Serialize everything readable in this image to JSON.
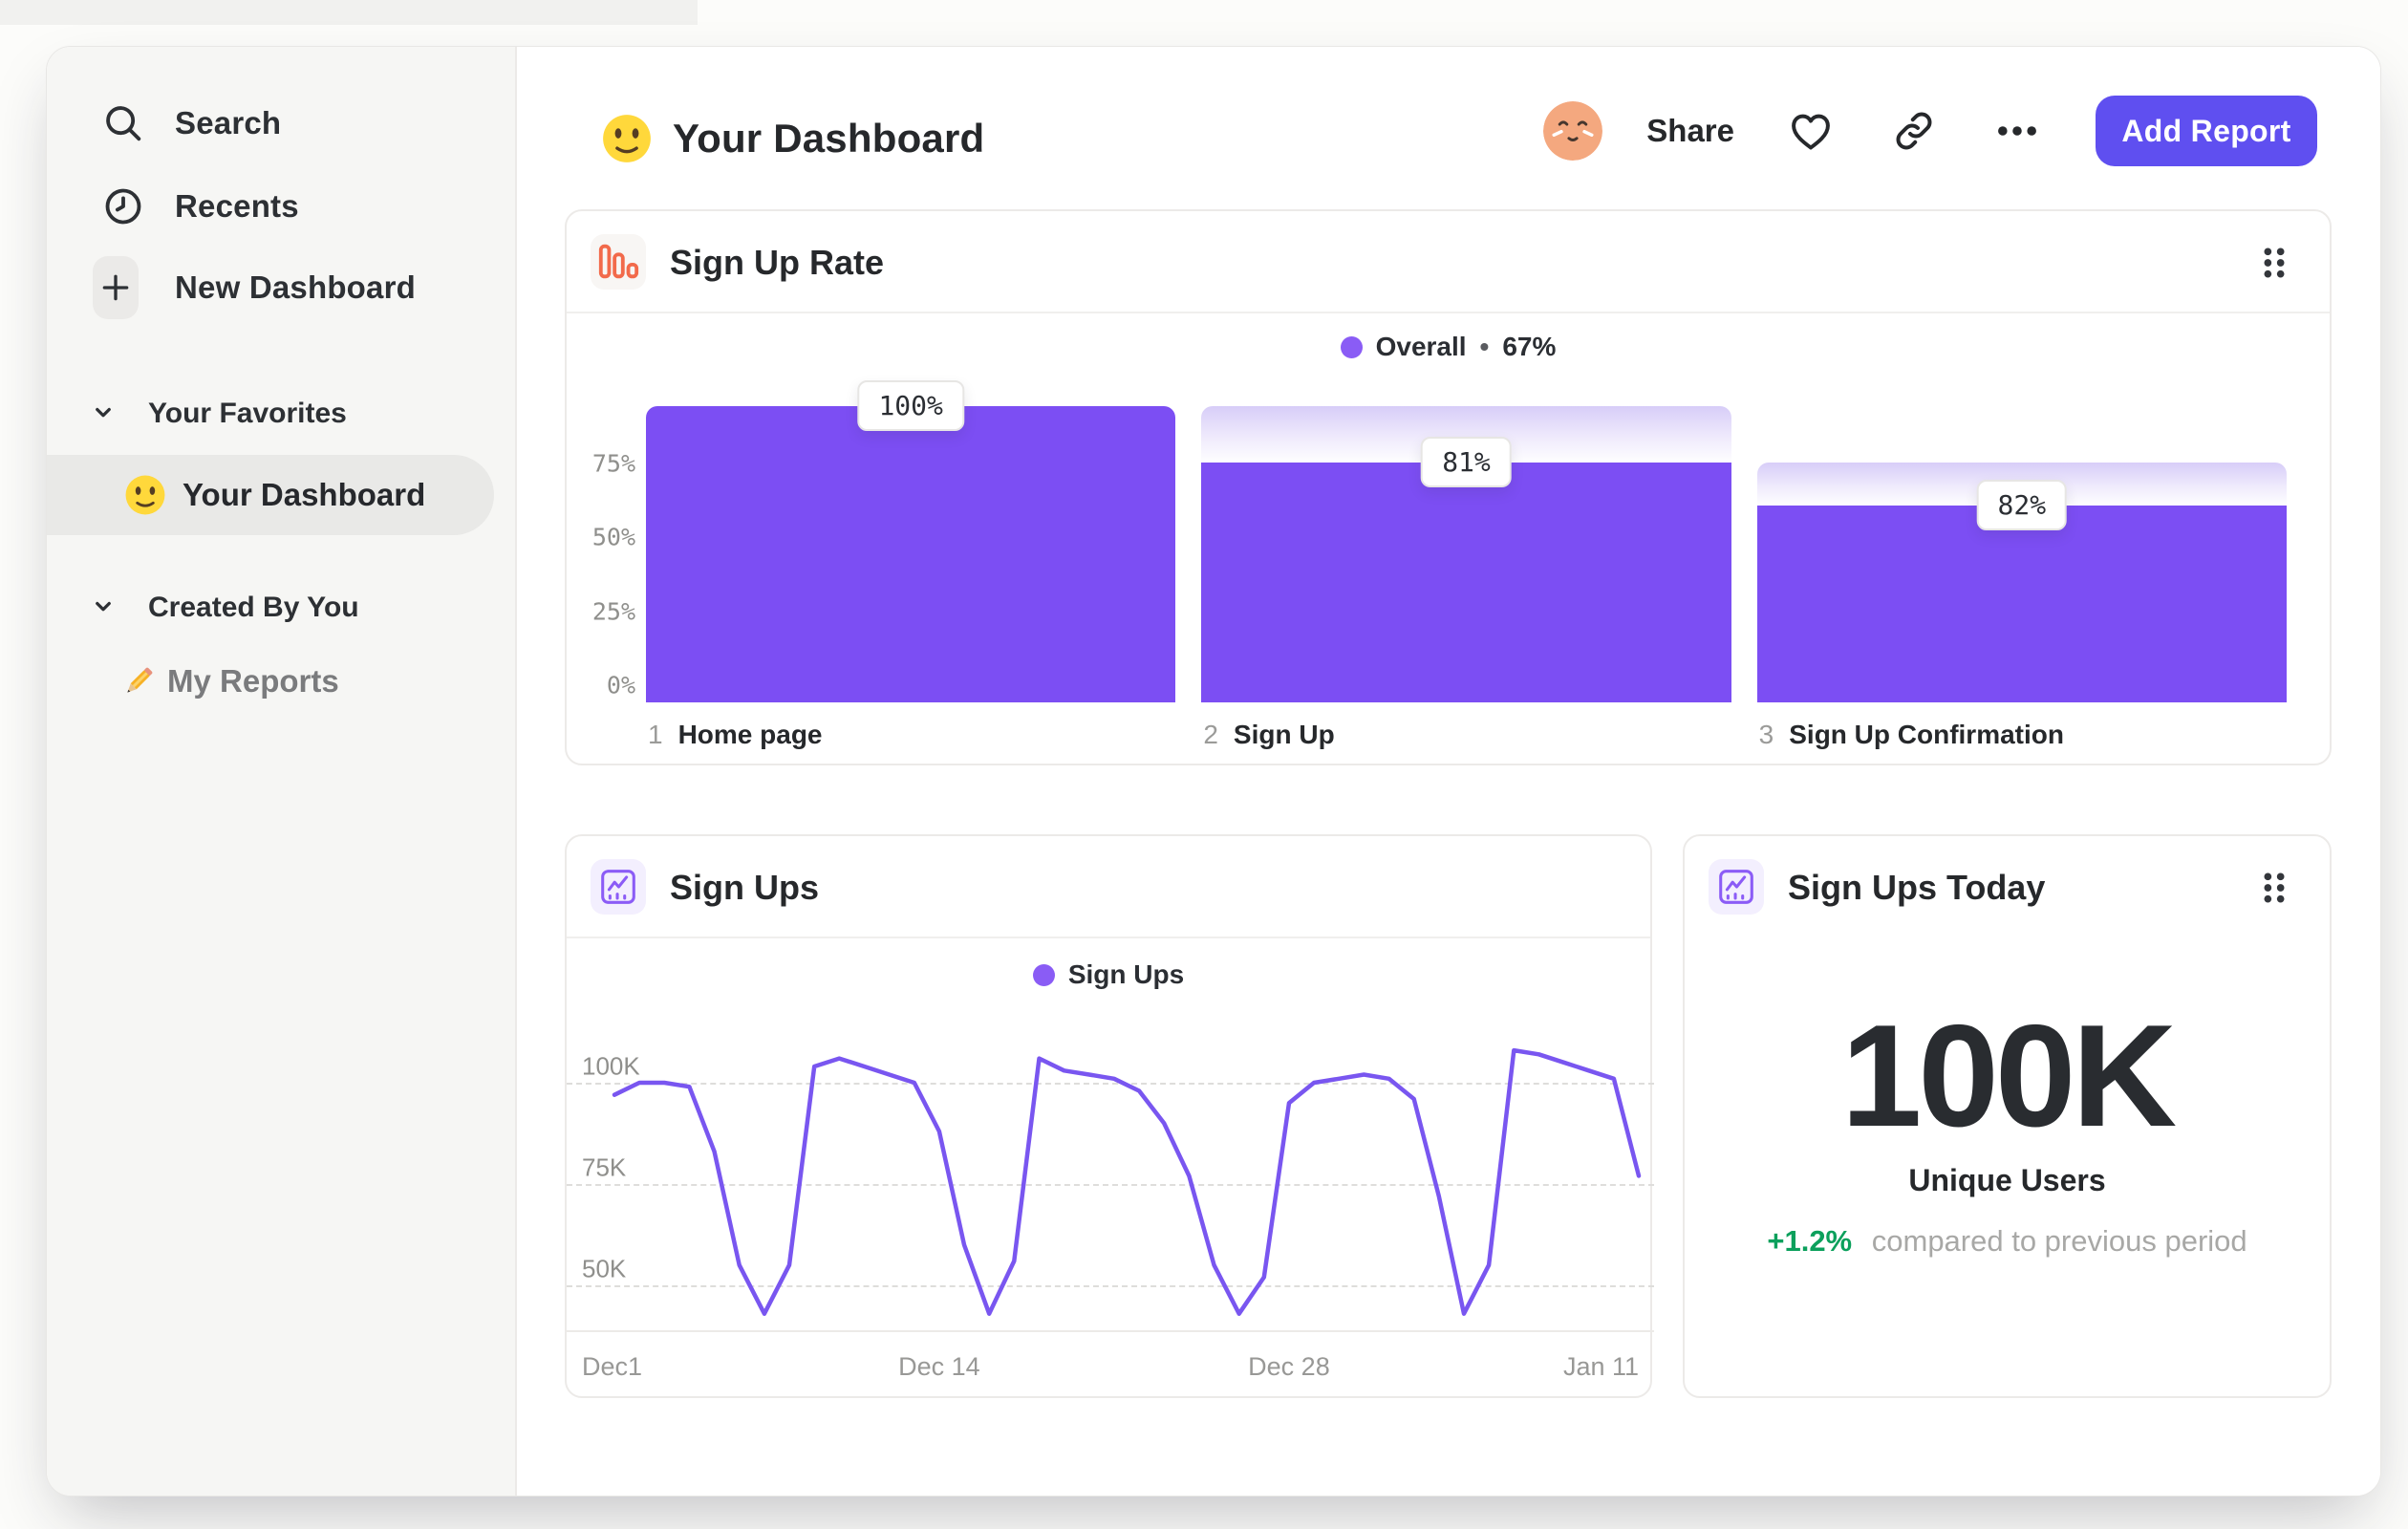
{
  "colors": {
    "accent_purple": "#7c4ef3",
    "line_purple": "#7956f0",
    "legend_dot": "#8a5cf5",
    "button_purple": "#5f4ff0",
    "icon_orange": "#f26a4b",
    "icon_purple": "#8b5cf6",
    "positive_green": "#0ca05c"
  },
  "sidebar": {
    "items": [
      {
        "label": "Search",
        "icon": "search-icon"
      },
      {
        "label": "Recents",
        "icon": "clock-icon"
      },
      {
        "label": "New Dashboard",
        "icon": "plus-icon"
      }
    ],
    "sections": [
      {
        "title": "Your Favorites",
        "items": [
          {
            "label": "Your Dashboard",
            "emoji": "smiley-emoji",
            "selected": true
          }
        ]
      },
      {
        "title": "Created By You",
        "items": [
          {
            "label": "My Reports",
            "emoji": "pencil-emoji",
            "selected": false
          }
        ]
      }
    ]
  },
  "header": {
    "emoji": "smiley-emoji",
    "title": "Your Dashboard",
    "share_label": "Share",
    "add_report_label": "Add Report",
    "icons": [
      "avatar",
      "heart-icon",
      "link-icon",
      "ellipsis-icon"
    ]
  },
  "cards": {
    "funnel": {
      "title": "Sign Up Rate",
      "legend_label": "Overall",
      "legend_sep": "•",
      "legend_value": "67%"
    },
    "line": {
      "title": "Sign Ups",
      "legend_label": "Sign Ups"
    },
    "metric": {
      "title": "Sign Ups Today",
      "value": "100K",
      "label": "Unique Users",
      "delta": "+1.2%",
      "delta_note": "compared to previous period"
    }
  },
  "chart_data": [
    {
      "type": "bar",
      "title": "Sign Up Rate",
      "legend": [
        {
          "name": "Overall",
          "value": "67%"
        }
      ],
      "ylim": [
        0,
        100
      ],
      "grid": false,
      "y_ticks": [
        {
          "label": "75%",
          "value": 75
        },
        {
          "label": "50%",
          "value": 50
        },
        {
          "label": "25%",
          "value": 25
        },
        {
          "label": "0%",
          "value": 0
        }
      ],
      "categories": [
        "Home page",
        "Sign Up",
        "Sign Up Confirmation"
      ],
      "steps": [
        {
          "index": "1",
          "label": "Home page",
          "conversion_label": "100%",
          "step_conversion_pct": 100,
          "overall_pct": 100,
          "prev_overall_pct": 100
        },
        {
          "index": "2",
          "label": "Sign Up",
          "conversion_label": "81%",
          "step_conversion_pct": 81,
          "overall_pct": 81,
          "prev_overall_pct": 100
        },
        {
          "index": "3",
          "label": "Sign Up Confirmation",
          "conversion_label": "82%",
          "step_conversion_pct": 82,
          "overall_pct": 66.4,
          "prev_overall_pct": 81
        }
      ]
    },
    {
      "type": "line",
      "title": "Sign Ups",
      "legend": [
        "Sign Ups"
      ],
      "ylim": [
        38,
        113
      ],
      "y_unit": "K",
      "grid": "dashed-horizontal",
      "y_ticks": [
        {
          "label": "100K",
          "value": 100
        },
        {
          "label": "75K",
          "value": 75
        },
        {
          "label": "50K",
          "value": 50
        }
      ],
      "x_ticks": [
        {
          "label": "Dec1",
          "index": 0
        },
        {
          "label": "Dec 14",
          "index": 13
        },
        {
          "label": "Dec 28",
          "index": 27
        },
        {
          "label": "Jan 11",
          "index": 41
        }
      ],
      "series": [
        {
          "name": "Sign Ups",
          "values": [
            97,
            100,
            100,
            99,
            83,
            55,
            43,
            55,
            104,
            106,
            104,
            102,
            100,
            88,
            60,
            43,
            56,
            106,
            103,
            102,
            101,
            98,
            90,
            77,
            55,
            43,
            52,
            95,
            100,
            101,
            102,
            101,
            96,
            72,
            43,
            55,
            108,
            107,
            105,
            103,
            101,
            77
          ]
        }
      ]
    }
  ]
}
